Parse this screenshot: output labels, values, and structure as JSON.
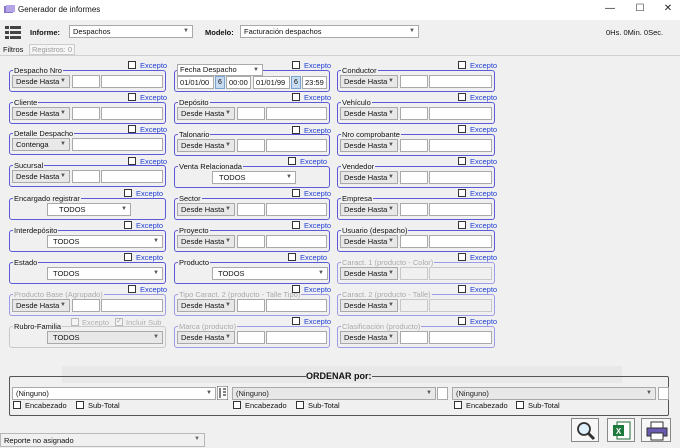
{
  "window": {
    "title": "Generador de informes",
    "minimize": "—",
    "maximize": "☐",
    "close": "✕"
  },
  "toolbar": {
    "informe_label": "Informe:",
    "informe_value": "Despachos",
    "modelo_label": "Modelo:",
    "modelo_value": "Facturación despachos",
    "timer": "0Hs. 0Min. 0Sec."
  },
  "tabs": {
    "filtros": "Filtros",
    "registros": "Registros: 0"
  },
  "common": {
    "excepto": "Excepto",
    "desde_hasta": "Desde Hasta",
    "contenga": "Contenga",
    "todos": "TODOS",
    "incluir_sub": "Incluir Sub"
  },
  "fecha": {
    "title": "Fecha Despacho",
    "d1": "01/01/00",
    "n1": "6",
    "t1": "00:00",
    "d2": "01/01/99",
    "n2": "6",
    "t2": "23:59"
  },
  "col1": [
    "Despacho Nro",
    "Cliente",
    "Detalle Despacho",
    "Sucursal",
    "Encargado registrar",
    "Interdepósito",
    "Estado",
    "Producto Base (Agrupado)",
    "Rubro-Familia"
  ],
  "col2": [
    "Depósito",
    "Talonario",
    "Venta Relacionada",
    "Sector",
    "Proyecto",
    "Producto",
    "Tipo Caract. 2 (producto - Talle Tipo)",
    "Marca (producto)"
  ],
  "col3": [
    "Conductor",
    "Vehículo",
    "Nro comprobante",
    "Vendedor",
    "Empresa",
    "Usuario (despacho)",
    "Caract. 1 (producto - Color)",
    "Caract. 2 (producto - Talle)",
    "Clasificación (producto)"
  ],
  "order": {
    "title": "ORDENAR  por:",
    "opt1": "(Ninguno)",
    "opt2": "(Ninguno)",
    "opt3": "(Ninguno)",
    "encabezado": "Encabezado",
    "subtotal": "Sub-Total"
  },
  "status": {
    "text": "Reporte no asignado"
  }
}
